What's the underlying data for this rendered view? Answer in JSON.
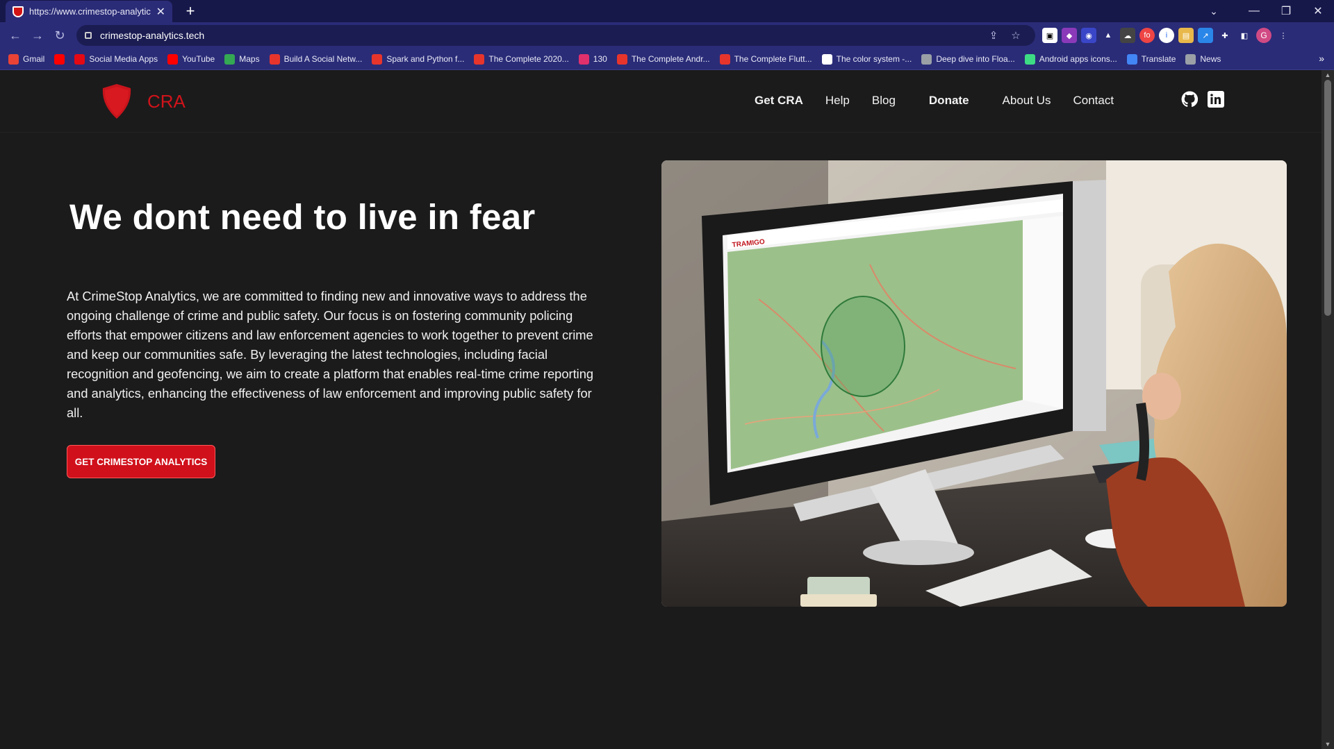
{
  "browser": {
    "tab_title": "https://www.crimestop-analytics.",
    "tab_close": "✕",
    "new_tab": "+",
    "url": "crimestop-analytics.tech",
    "window_controls": {
      "tab_search": "⌄",
      "minimize": "—",
      "restore": "❐",
      "close": "✕"
    },
    "bookmarks": [
      {
        "label": "Gmail",
        "icon": "gmail-icon",
        "color": "#ea4335"
      },
      {
        "label": "",
        "icon": "youtube-icon",
        "color": "#ff0000"
      },
      {
        "label": "Social Media Apps",
        "icon": "netflix-icon",
        "color": "#e50914"
      },
      {
        "label": "YouTube",
        "icon": "youtube-icon",
        "color": "#ff0000"
      },
      {
        "label": "Maps",
        "icon": "maps-icon",
        "color": "#34a853"
      },
      {
        "label": "Build A Social Netw...",
        "icon": "udemy-icon",
        "color": "#e8352c"
      },
      {
        "label": "Spark and Python f...",
        "icon": "udemy-icon",
        "color": "#e8352c"
      },
      {
        "label": "The Complete 2020...",
        "icon": "udemy-icon",
        "color": "#e8352c"
      },
      {
        "label": "130",
        "icon": "instagram-icon",
        "color": "#e1306c"
      },
      {
        "label": "The Complete Andr...",
        "icon": "udemy-icon",
        "color": "#e8352c"
      },
      {
        "label": "The Complete Flutt...",
        "icon": "udemy-icon",
        "color": "#e8352c"
      },
      {
        "label": "The color system -...",
        "icon": "page-icon",
        "color": "#ffffff"
      },
      {
        "label": "Deep dive into Floa...",
        "icon": "globe-icon",
        "color": "#9aa0a6"
      },
      {
        "label": "Android apps icons...",
        "icon": "android-icon",
        "color": "#3ddc84"
      },
      {
        "label": "Translate",
        "icon": "translate-icon",
        "color": "#4285f4"
      },
      {
        "label": "News",
        "icon": "globe-icon",
        "color": "#9aa0a6"
      }
    ],
    "bookmarks_more": "»"
  },
  "site": {
    "brand_name": "CRA",
    "nav": [
      {
        "label": "Get CRA",
        "bold": true
      },
      {
        "label": "Help",
        "bold": false
      },
      {
        "label": "Blog",
        "bold": false
      },
      {
        "label": "Donate",
        "bold": true
      },
      {
        "label": "About Us",
        "bold": false
      },
      {
        "label": "Contact",
        "bold": false
      }
    ],
    "accent_color": "#d0131b",
    "hero": {
      "title": "We dont need to live in fear",
      "paragraph": "At CrimeStop Analytics, we are committed to finding new and innovative ways to address the ongoing challenge of crime and public safety. Our focus is on fostering community policing efforts that empower citizens and law enforcement agencies to work together to prevent crime and keep our communities safe. By leveraging the latest technologies, including facial recognition and geofencing, we aim to create a platform that enables real-time crime reporting and analytics, enhancing the effectiveness of law enforcement and improving public safety for all.",
      "cta": "GET CRIMESTOP ANALYTICS"
    },
    "illustration": {
      "screen_logo": "TRAMIGO"
    }
  }
}
